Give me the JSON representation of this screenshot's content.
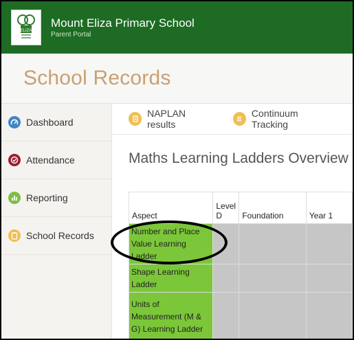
{
  "header": {
    "school_name": "Mount Eliza Primary School",
    "portal_label": "Parent Portal",
    "logo_icon": "school-tree-logo-icon",
    "background": "#1e6b24"
  },
  "page": {
    "title": "School Records",
    "title_color": "#c9a073"
  },
  "sidebar": {
    "items": [
      {
        "label": "Dashboard",
        "icon": "dashboard-icon",
        "color": "#3f86c4"
      },
      {
        "label": "Attendance",
        "icon": "check-circle-icon",
        "color": "#9c1f2d"
      },
      {
        "label": "Reporting",
        "icon": "bar-chart-icon",
        "color": "#7cbf44"
      },
      {
        "label": "School Records",
        "icon": "clipboard-icon",
        "color": "#f0bf52"
      }
    ]
  },
  "tabs": [
    {
      "label": "NAPLAN results",
      "icon": "document-icon"
    },
    {
      "label": "Continuum Tracking",
      "icon": "list-icon"
    }
  ],
  "section": {
    "title": "Maths Learning Ladders Overview"
  },
  "table": {
    "headers": [
      "Aspect",
      "Level D",
      "Foundation",
      "Year 1"
    ],
    "rows": [
      {
        "aspect": "Number and Place Value Learning Ladder"
      },
      {
        "aspect": "Shape Learning Ladder"
      },
      {
        "aspect": "Units of Measurement (M & G) Learning Ladder"
      }
    ],
    "aspect_color": "#7bc739",
    "cell_color": "#c6c6c6"
  },
  "annotation": {
    "type": "hand-drawn-ellipse",
    "target": "Number and Place Value Learning Ladder",
    "color": "#000000"
  }
}
